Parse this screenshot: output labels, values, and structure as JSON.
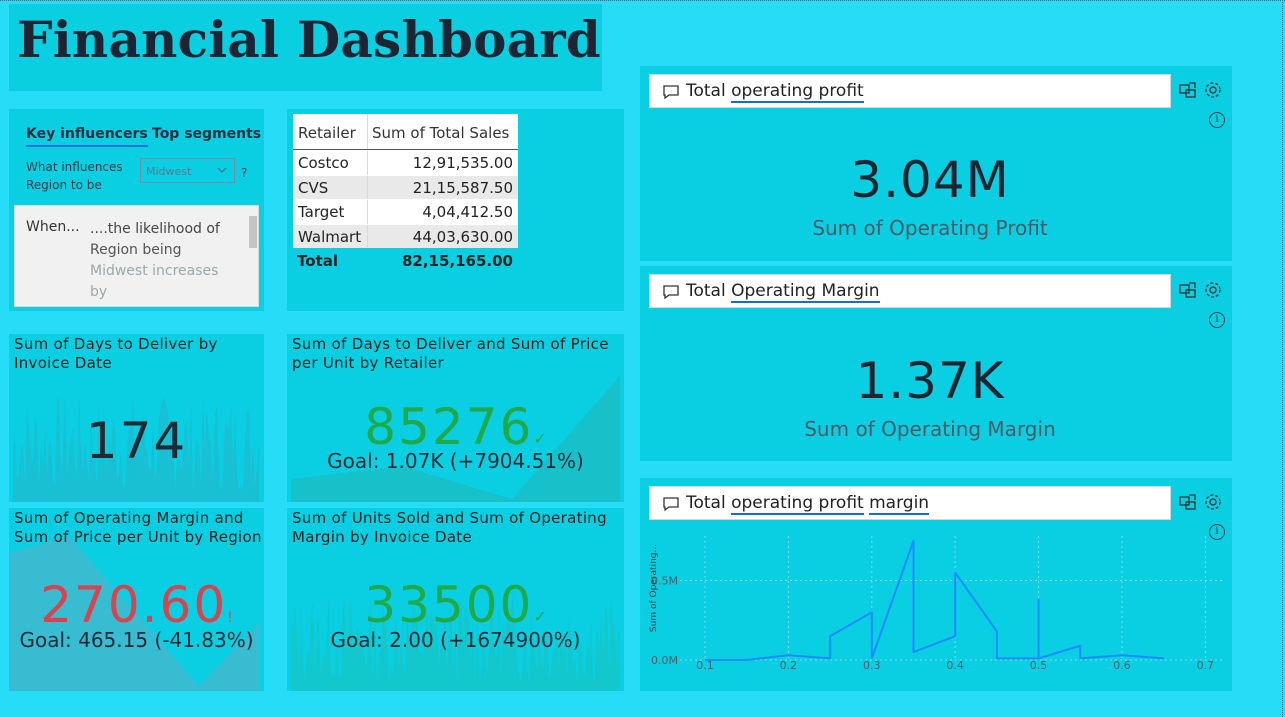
{
  "title": "Financial Dashboard",
  "key_influencers": {
    "tabs": [
      "Key influencers",
      "Top segments"
    ],
    "question": "What influences Region to be",
    "selected": "Midwest",
    "help": "?",
    "card_when": "When...",
    "card_text_1": "....the likelihood of",
    "card_text_2": "Region being",
    "card_text_3": "Midwest increases by"
  },
  "table": {
    "columns": [
      "Retailer",
      "Sum of Total Sales"
    ],
    "rows": [
      [
        "Costco",
        "12,91,535.00"
      ],
      [
        "CVS",
        "21,15,587.50"
      ],
      [
        "Target",
        "4,04,412.50"
      ],
      [
        "Walmart",
        "44,03,630.00"
      ]
    ],
    "total_label": "Total",
    "total_value": "82,15,165.00"
  },
  "kpi1": {
    "title": "Sum of Days to Deliver by Invoice Date",
    "value": "174"
  },
  "kpi2": {
    "title": "Sum of Days to Deliver and Sum of Price per Unit by Retailer",
    "value": "85276",
    "goal": "Goal: 1.07K (+7904.51%)",
    "status": "up",
    "color": "#1faa47"
  },
  "kpi3": {
    "title": "Sum of Operating Margin and Sum of Price per Unit by Region",
    "value": "270.60",
    "goal": "Goal: 465.15 (-41.83%)",
    "status": "down",
    "color": "#d9434f"
  },
  "kpi4": {
    "title": "Sum of Units Sold and Sum of Operating Margin by Invoice Date",
    "value": "33500",
    "goal": "Goal: 2.00 (+1674900%)",
    "status": "up",
    "color": "#1faa47"
  },
  "qa1": {
    "prefix": "Total",
    "terms": [
      "operating profit"
    ],
    "value": "3.04M",
    "label": "Sum of Operating Profit"
  },
  "qa2": {
    "prefix": "Total",
    "terms": [
      "Operating Margin"
    ],
    "value": "1.37K",
    "label": "Sum of Operating Margin"
  },
  "qa3": {
    "prefix": "Total",
    "terms": [
      "operating profit",
      "margin"
    ]
  },
  "icons": {
    "chat": "chat-bubble-icon",
    "pin": "pin-visual-icon",
    "settings": "gear-icon",
    "info": "info-icon"
  },
  "chart_data": {
    "type": "line",
    "ylabel": "Sum of Operating...",
    "xlabel": "",
    "xlim": [
      0.07,
      0.72
    ],
    "ylim": [
      0,
      0.78
    ],
    "xticks": [
      "0.1",
      "0.2",
      "0.3",
      "0.4",
      "0.5",
      "0.6",
      "0.7"
    ],
    "yticks": [
      "0.0M",
      "0.5M"
    ],
    "color": "#1a8cff",
    "series": [
      {
        "x": [
          0.1,
          0.15,
          0.2,
          0.25,
          0.25,
          0.3,
          0.3,
          0.35,
          0.35,
          0.4,
          0.4,
          0.45,
          0.45,
          0.5,
          0.5,
          0.5,
          0.55,
          0.55,
          0.6,
          0.65
        ],
        "y": [
          0.0,
          0.0,
          0.03,
          0.01,
          0.15,
          0.3,
          0.01,
          0.75,
          0.05,
          0.15,
          0.55,
          0.18,
          0.01,
          0.01,
          0.38,
          0.01,
          0.09,
          0.01,
          0.03,
          0.01
        ]
      }
    ]
  }
}
